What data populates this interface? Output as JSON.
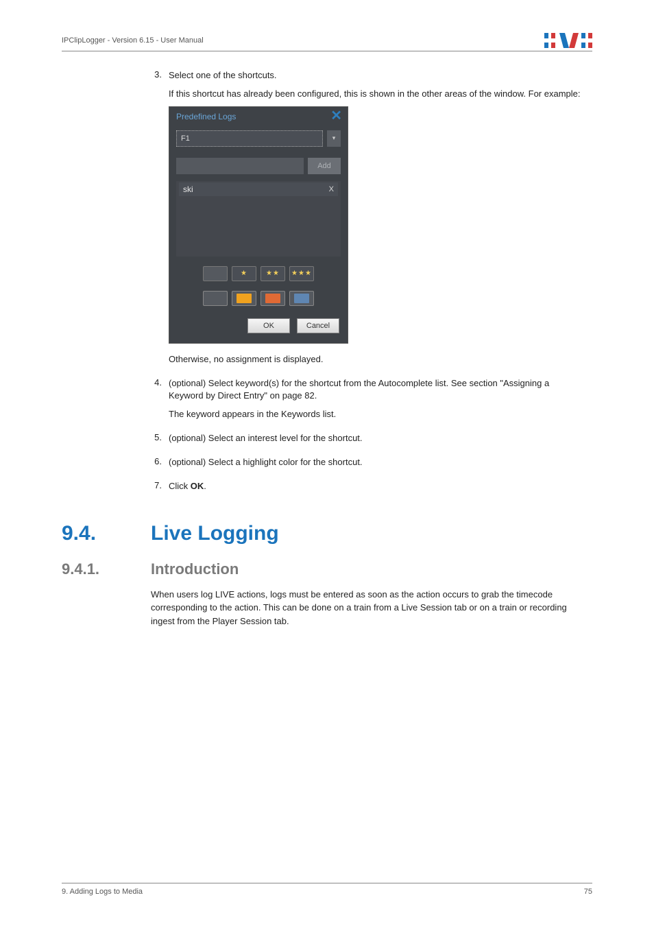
{
  "header": {
    "doc_title": "IPClipLogger - Version 6.15 - User Manual"
  },
  "steps_a": [
    {
      "num": "3.",
      "paras": [
        "Select one of the shortcuts.",
        "If this shortcut has already been configured, this is shown in the other areas of the window. For example:"
      ]
    }
  ],
  "dialog": {
    "title": "Predefined Logs",
    "close": "✕",
    "fkey": "F1",
    "dropdown_glyph": "▾",
    "add_label": "Add",
    "keyword": "ski",
    "kw_x": "X",
    "stars": [
      "",
      "★",
      "★★",
      "★★★"
    ],
    "colors": [
      "",
      "#f0a21f",
      "#e06a35",
      "#5f86b2"
    ],
    "ok": "OK",
    "cancel": "Cancel"
  },
  "after_dialog": "Otherwise, no assignment is displayed.",
  "steps_b": [
    {
      "num": "4.",
      "paras": [
        "(optional) Select keyword(s) for the shortcut from the Autocomplete list. See section \"Assigning a Keyword by Direct Entry\" on page 82.",
        "The keyword appears in the Keywords list."
      ]
    },
    {
      "num": "5.",
      "paras": [
        "(optional) Select an interest level for the shortcut."
      ]
    },
    {
      "num": "6.",
      "paras": [
        "(optional) Select a highlight color for the shortcut."
      ]
    },
    {
      "num": "7.",
      "paras": [
        "Click OK."
      ],
      "bold_last_word": true
    }
  ],
  "section": {
    "num": "9.4.",
    "title": "Live Logging",
    "sub_num": "9.4.1.",
    "sub_title": "Introduction",
    "intro": "When users log LIVE actions, logs must be entered as soon as the action occurs to grab the timecode corresponding to the action. This can be done on a train from a Live Session tab or on a train or recording ingest from the Player Session tab."
  },
  "footer": {
    "left": "9. Adding Logs to Media",
    "right": "75"
  }
}
